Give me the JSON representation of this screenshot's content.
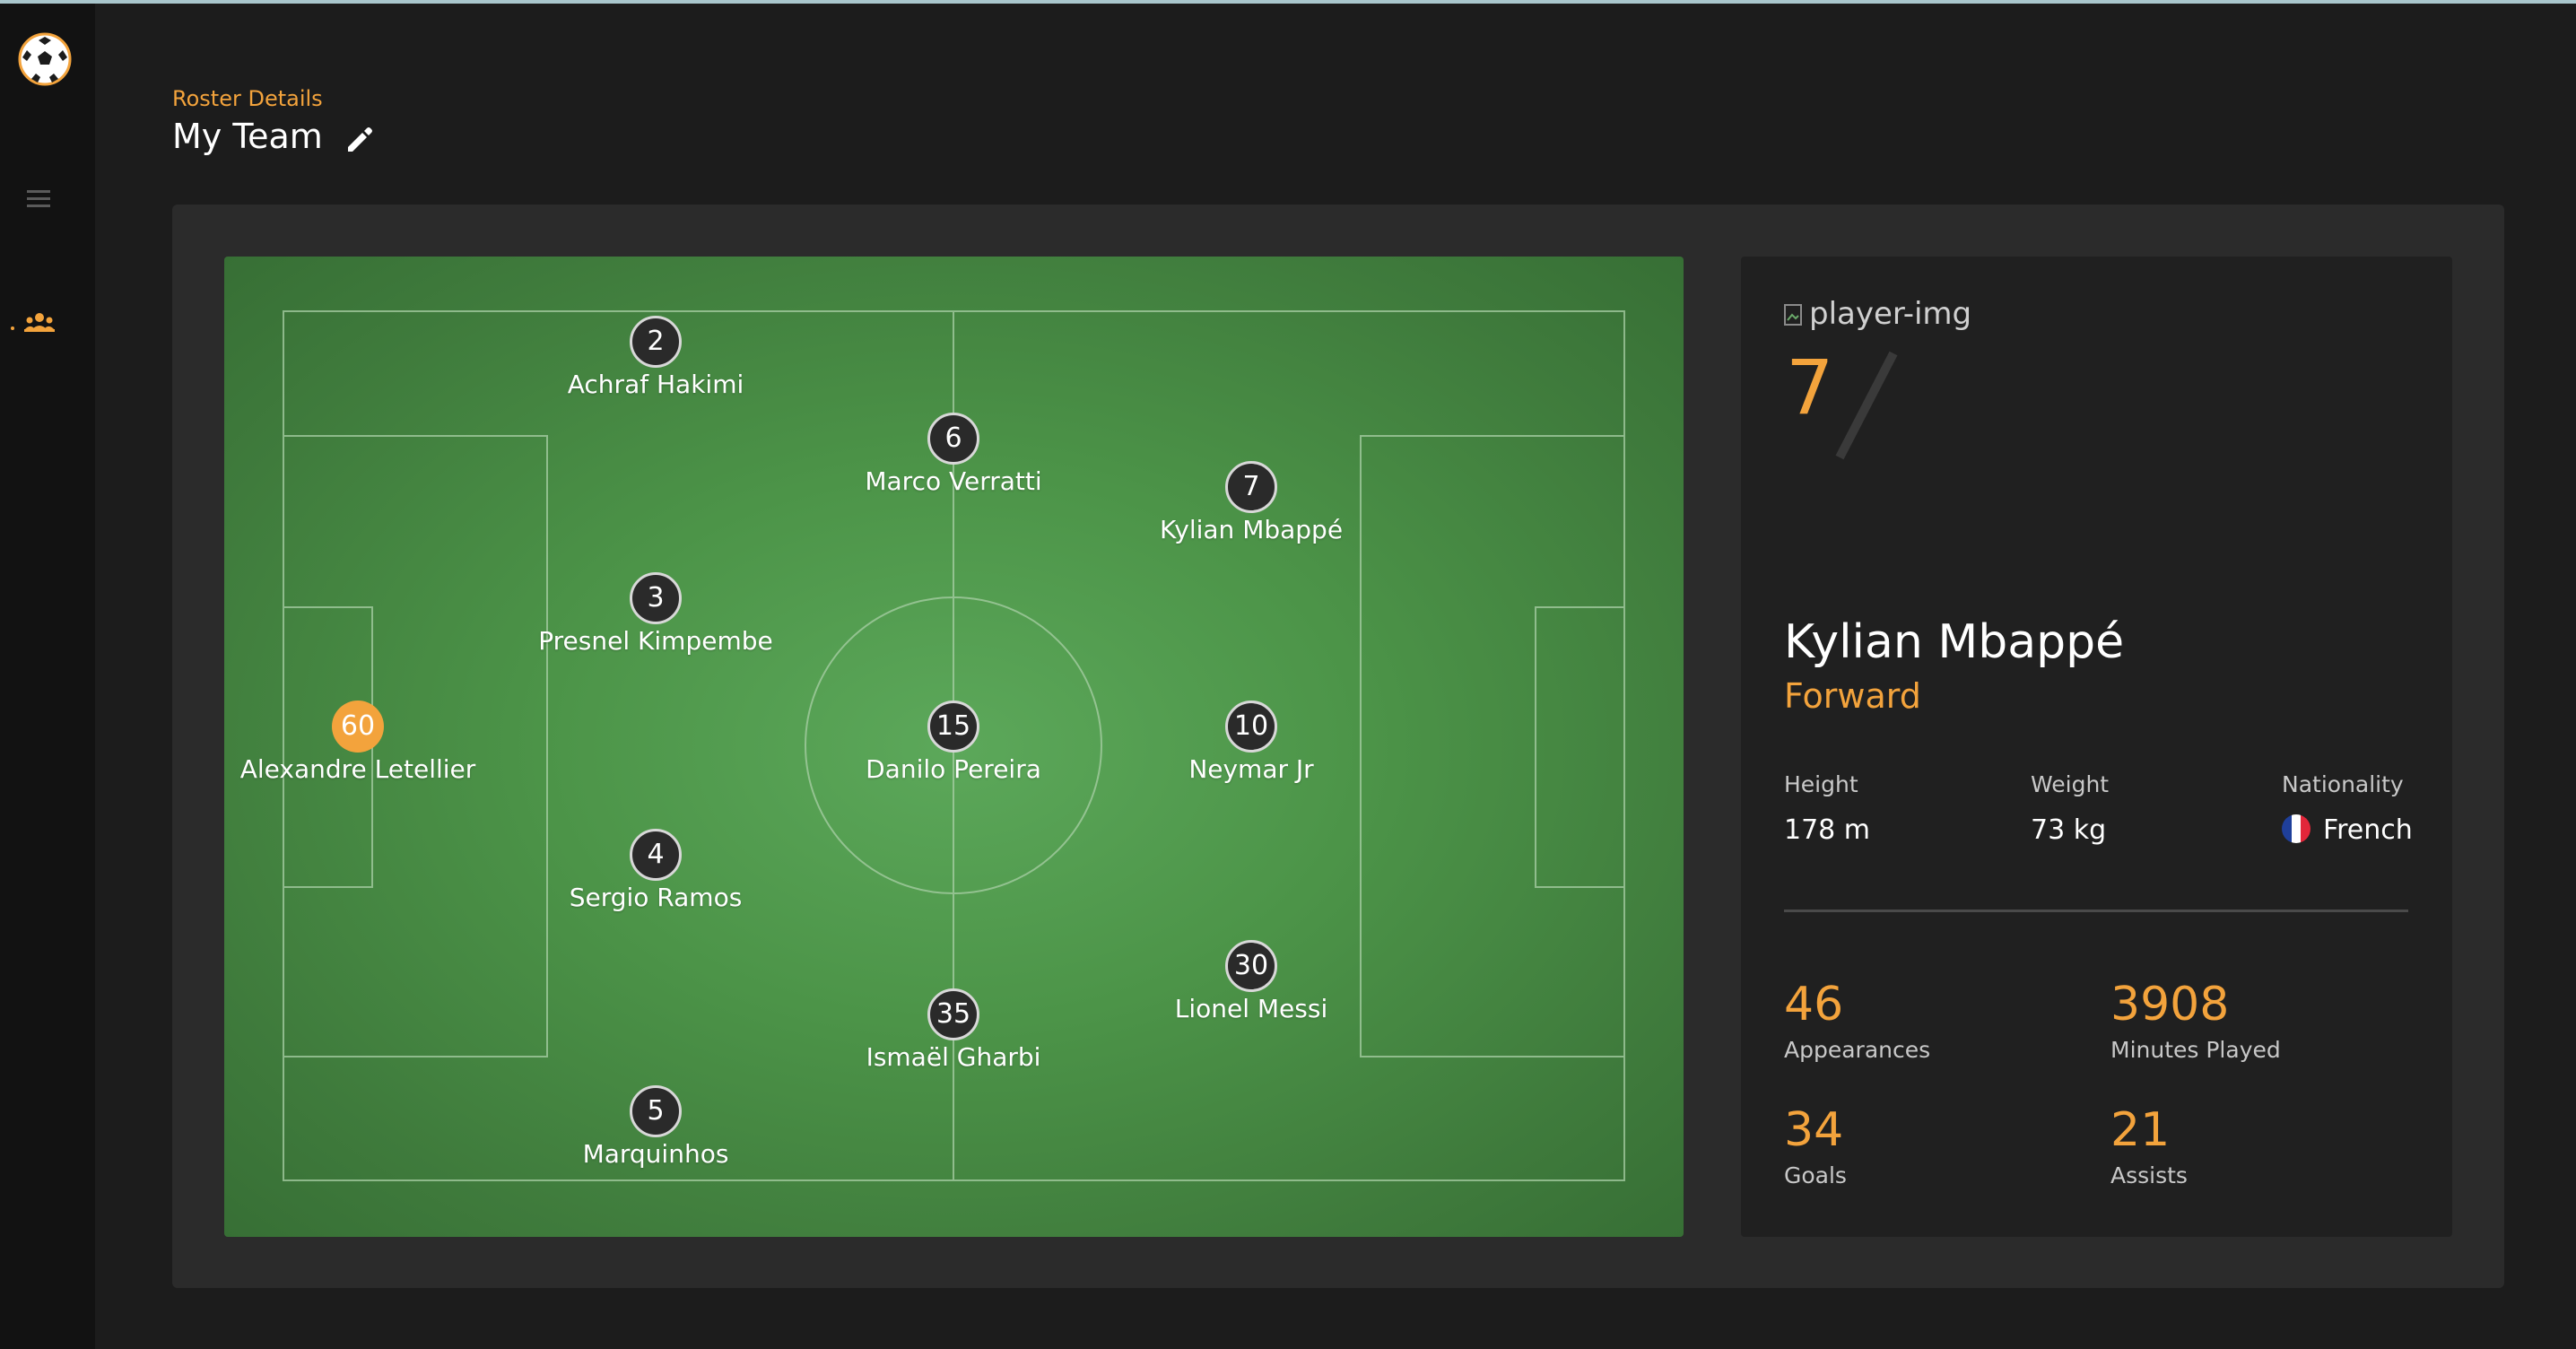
{
  "colors": {
    "accent": "#f3a33c",
    "background": "#1c1c1c",
    "sidebar": "#121212",
    "panel": "#2b2b2b",
    "card": "#202020",
    "pitch_green": "#4c9448"
  },
  "sidebar": {
    "logo_icon": "soccer-ball-icon",
    "menu_icon": "hamburger-menu-icon",
    "team_icon": "team-users-icon"
  },
  "header": {
    "subtitle": "Roster Details",
    "title": "My Team",
    "edit_icon": "pencil-icon"
  },
  "pitch": {
    "players": [
      {
        "number": "2",
        "name": "Achraf Hakimi"
      },
      {
        "number": "6",
        "name": "Marco Verratti"
      },
      {
        "number": "7",
        "name": "Kylian Mbappé"
      },
      {
        "number": "3",
        "name": "Presnel Kimpembe"
      },
      {
        "number": "60",
        "name": "Alexandre Letellier"
      },
      {
        "number": "15",
        "name": "Danilo Pereira"
      },
      {
        "number": "10",
        "name": "Neymar Jr"
      },
      {
        "number": "4",
        "name": "Sergio Ramos"
      },
      {
        "number": "30",
        "name": "Lionel Messi"
      },
      {
        "number": "35",
        "name": "Ismaël Gharbi"
      },
      {
        "number": "5",
        "name": "Marquinhos"
      }
    ]
  },
  "player_card": {
    "image_alt": "player-img",
    "number": "7",
    "name": "Kylian Mbappé",
    "position": "Forward",
    "height_label": "Height",
    "height_value": "178 m",
    "weight_label": "Weight",
    "weight_value": "73 kg",
    "nationality_label": "Nationality",
    "nationality_value": "French",
    "flag_icon": "france-flag-icon",
    "stats": {
      "appearances_value": "46",
      "appearances_label": "Appearances",
      "minutes_value": "3908",
      "minutes_label": "Minutes Played",
      "goals_value": "34",
      "goals_label": "Goals",
      "assists_value": "21",
      "assists_label": "Assists"
    }
  }
}
